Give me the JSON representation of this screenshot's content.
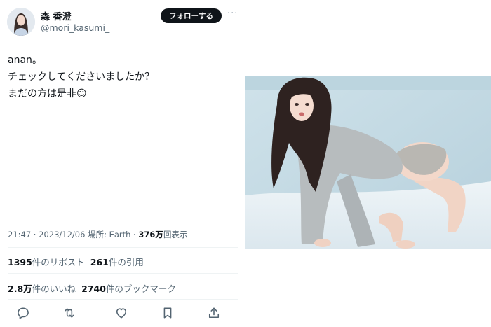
{
  "user": {
    "display_name": "森 香澄",
    "handle": "@mori_kasumi_",
    "follow_label": "フォローする",
    "more_icon": "more-icon"
  },
  "tweet": {
    "lines": [
      "anan。",
      "チェックしてくださいましたか？",
      "まだの方は是非☺︎"
    ],
    "time": "21:47",
    "sep": " · ",
    "date": "2023/12/06",
    "location": " 場所: Earth · ",
    "views": "376万",
    "views_label": "回表示"
  },
  "stats": {
    "reposts": "1395",
    "reposts_label": "件のリポスト",
    "quotes": "261",
    "quotes_label": "件の引用",
    "likes": "2.8万",
    "likes_label": "件のいいね",
    "bookmarks": "2740",
    "bookmarks_label": "件のブックマーク"
  },
  "actions": [
    "reply-icon",
    "repost-icon",
    "like-icon",
    "bookmark-icon",
    "share-icon"
  ]
}
